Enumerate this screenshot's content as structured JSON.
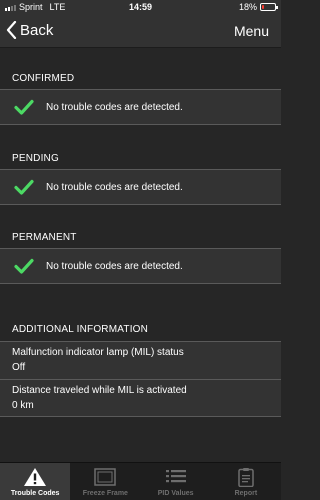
{
  "status_bar": {
    "carrier": "Sprint",
    "network": "LTE",
    "time": "14:59",
    "battery_percent": "18%",
    "battery_level": 0.18
  },
  "nav": {
    "back_label": "Back",
    "menu_label": "Menu"
  },
  "sections": {
    "confirmed": {
      "header": "CONFIRMED",
      "message": "No trouble codes are detected."
    },
    "pending": {
      "header": "PENDING",
      "message": "No trouble codes are detected."
    },
    "permanent": {
      "header": "PERMANENT",
      "message": "No trouble codes are detected."
    }
  },
  "additional": {
    "header": "ADDITIONAL INFORMATION",
    "items": [
      {
        "label": "Malfunction indicator lamp (MIL) status",
        "value": "Off"
      },
      {
        "label": "Distance traveled while MIL is activated",
        "value": "0 km"
      }
    ]
  },
  "tabs": [
    {
      "label": "Trouble Codes",
      "icon": "warning-icon",
      "active": true
    },
    {
      "label": "Freeze Frame",
      "icon": "freeze-frame-icon",
      "active": false
    },
    {
      "label": "PID Values",
      "icon": "pid-list-icon",
      "active": false
    },
    {
      "label": "Report",
      "icon": "report-clipboard-icon",
      "active": false
    }
  ],
  "colors": {
    "check": "#4cd964",
    "battery_low": "#ff3b30",
    "background": "#262626",
    "row": "#333333"
  }
}
